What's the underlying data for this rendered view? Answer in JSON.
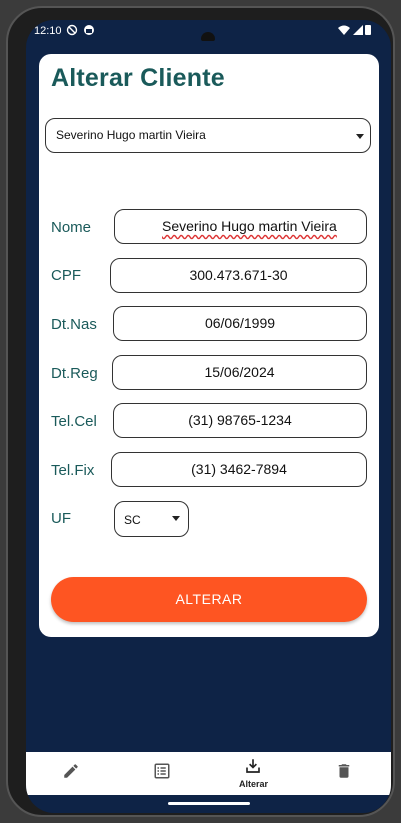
{
  "statusbar": {
    "time": "12:10"
  },
  "page": {
    "title": "Alterar Cliente"
  },
  "client_select": {
    "selected": "Severino Hugo martin Vieira"
  },
  "form": {
    "nome": {
      "label": "Nome",
      "value": "Severino Hugo martin Vieira"
    },
    "cpf": {
      "label": "CPF",
      "value": "300.473.671-30"
    },
    "dtnas": {
      "label": "Dt.Nas",
      "value": "06/06/1999"
    },
    "dtreg": {
      "label": "Dt.Reg",
      "value": "15/06/2024"
    },
    "telcel": {
      "label": "Tel.Cel",
      "value": "(31) 98765-1234"
    },
    "telfix": {
      "label": "Tel.Fix",
      "value": "(31) 3462-7894"
    },
    "uf": {
      "label": "UF",
      "value": "SC"
    }
  },
  "actions": {
    "alterar_label": "ALTERAR"
  },
  "bottomnav": {
    "items": [
      {
        "icon": "pencil-icon",
        "label": ""
      },
      {
        "icon": "list-icon",
        "label": ""
      },
      {
        "icon": "download-tray-icon",
        "label": "Alterar"
      },
      {
        "icon": "trash-icon",
        "label": ""
      }
    ]
  },
  "colors": {
    "accent": "#fe5522",
    "title": "#1a5a5a",
    "background": "#0e2346"
  }
}
